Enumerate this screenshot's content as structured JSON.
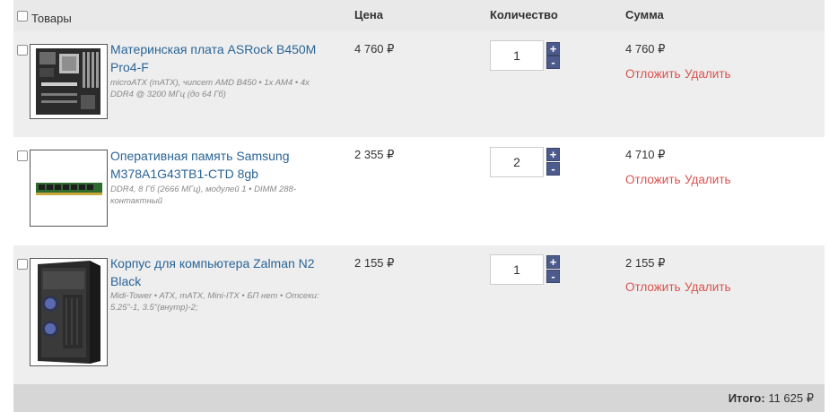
{
  "header": {
    "goods": "Товары",
    "price": "Цена",
    "quantity": "Количество",
    "sum": "Сумма"
  },
  "items": [
    {
      "name": "Материнская плата ASRock B450M Pro4-F",
      "desc": "microATX (mATX), чипсет AMD B450 • 1x AM4 • 4x DDR4 @ 3200 МГц (до 64 Гб)",
      "price": "4 760 ₽",
      "qty": "1",
      "sum": "4 760 ₽",
      "image": "motherboard-image"
    },
    {
      "name": "Оперативная память Samsung M378A1G43TB1-CTD 8gb",
      "desc": "DDR4, 8 Гб (2666 МГц), модулей 1 • DIMM 288-контактный",
      "price": "2 355 ₽",
      "qty": "2",
      "sum": "4 710 ₽",
      "image": "ram-module-image"
    },
    {
      "name": "Корпус для компьютера Zalman N2 Black",
      "desc": "Midi-Tower • ATX, mATX, Mini-ITX • БП нет • Отсеки: 5.25\"-1, 3.5\"(внутр)-2;",
      "price": "2 155 ₽",
      "qty": "1",
      "sum": "2 155 ₽",
      "image": "pc-case-image"
    }
  ],
  "actions": {
    "postpone": "Отложить",
    "delete": "Удалить",
    "plus": "+",
    "minus": "-"
  },
  "total": {
    "label": "Итого:",
    "value": "11 625 ₽"
  },
  "colors": {
    "link": "#2a6496",
    "action": "#d9534f",
    "stepper": "#4d5b8c",
    "row_shade": "#eeeeee",
    "header_bg": "#e9e9e9",
    "total_bg": "#d6d6d6"
  }
}
